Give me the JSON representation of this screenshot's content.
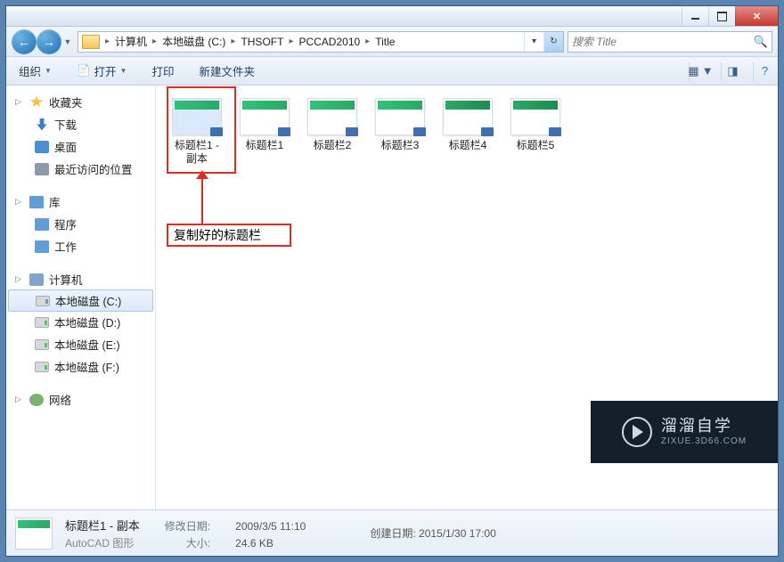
{
  "window_controls": {
    "min": "minimize",
    "max": "maximize",
    "close": "close"
  },
  "breadcrumb": [
    "计算机",
    "本地磁盘 (C:)",
    "THSOFT",
    "PCCAD2010",
    "Title"
  ],
  "search": {
    "placeholder": "搜索 Title"
  },
  "toolbar": {
    "organize": "组织",
    "open": "打开",
    "print": "打印",
    "new_folder": "新建文件夹"
  },
  "sidebar": {
    "favorites": {
      "label": "收藏夹",
      "items": [
        "下载",
        "桌面",
        "最近访问的位置"
      ]
    },
    "libraries": {
      "label": "库",
      "items": [
        "程序",
        "工作"
      ]
    },
    "computer": {
      "label": "计算机",
      "items": [
        "本地磁盘 (C:)",
        "本地磁盘 (D:)",
        "本地磁盘 (E:)",
        "本地磁盘 (F:)"
      ]
    },
    "network": {
      "label": "网络"
    }
  },
  "files": [
    {
      "name": "标题栏1 - 副本",
      "selected": true
    },
    {
      "name": "标题栏1"
    },
    {
      "name": "标题栏2"
    },
    {
      "name": "标题栏3"
    },
    {
      "name": "标题栏4"
    },
    {
      "name": "标题栏5"
    }
  ],
  "annotation": {
    "label": "复制好的标题栏"
  },
  "status": {
    "filename": "标题栏1 - 副本",
    "filetype": "AutoCAD 图形",
    "mod_label": "修改日期:",
    "mod_value": "2009/3/5 11:10",
    "created_label": "创建日期:",
    "created_value": "2015/1/30 17:00",
    "size_label": "大小:",
    "size_value": "24.6 KB"
  },
  "brand": {
    "line1": "溜溜自学",
    "line2": "ZIXUE.3D66.COM"
  }
}
